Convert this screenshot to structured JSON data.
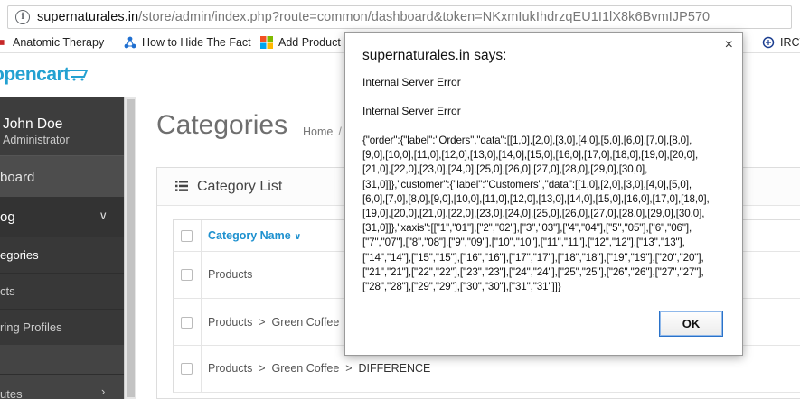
{
  "browser": {
    "url_host": "supernaturales.in",
    "url_path": "/store/admin/index.php?route=common/dashboard&token=NKxmIukIhdrzqEU1I1lX8k6BvmIJP570",
    "bookmarks": [
      {
        "label": "Anatomic Therapy",
        "icon": "red-bookmark-icon"
      },
      {
        "label": "How to Hide The Fact",
        "icon": "network-icon"
      },
      {
        "label": "Add Product C",
        "icon": "windows-icon"
      },
      {
        "label": "IRCT",
        "icon": "irctc-icon"
      }
    ]
  },
  "app": {
    "logo": "opencart",
    "user_name": "John Doe",
    "user_role": "Administrator"
  },
  "sidebar": {
    "dashboard": "board",
    "catalog": "og",
    "categories": "egories",
    "products": "cts",
    "recurring": "ring Profiles",
    "routes": "utes"
  },
  "page": {
    "title": "Categories",
    "breadcrumb_home": "Home",
    "breadcrumb_sep": "/"
  },
  "panel": {
    "title": "Category List",
    "column_header": "Category Name",
    "rows": [
      {
        "path": "Products",
        "leaf": ""
      },
      {
        "path": "Products  >  Green Coffee",
        "leaf": ""
      },
      {
        "path": "Products  >  Green Coffee  >  ",
        "leaf": "DIFFERENCE"
      }
    ]
  },
  "dialog": {
    "title": "supernaturales.in says:",
    "message1": "Internal Server Error",
    "message2": "Internal Server Error",
    "json_text": "{\"order\":{\"label\":\"Orders\",\"data\":[[1,0],[2,0],[3,0],[4,0],[5,0],[6,0],[7,0],[8,0],\n[9,0],[10,0],[11,0],[12,0],[13,0],[14,0],[15,0],[16,0],[17,0],[18,0],[19,0],[20,0],\n[21,0],[22,0],[23,0],[24,0],[25,0],[26,0],[27,0],[28,0],[29,0],[30,0],\n[31,0]]},\"customer\":{\"label\":\"Customers\",\"data\":[[1,0],[2,0],[3,0],[4,0],[5,0],\n[6,0],[7,0],[8,0],[9,0],[10,0],[11,0],[12,0],[13,0],[14,0],[15,0],[16,0],[17,0],[18,0],\n[19,0],[20,0],[21,0],[22,0],[23,0],[24,0],[25,0],[26,0],[27,0],[28,0],[29,0],[30,0],\n[31,0]]},\"xaxis\":[[\"1\",\"01\"],[\"2\",\"02\"],[\"3\",\"03\"],[\"4\",\"04\"],[\"5\",\"05\"],[\"6\",\"06\"],\n[\"7\",\"07\"],[\"8\",\"08\"],[\"9\",\"09\"],[\"10\",\"10\"],[\"11\",\"11\"],[\"12\",\"12\"],[\"13\",\"13\"],\n[\"14\",\"14\"],[\"15\",\"15\"],[\"16\",\"16\"],[\"17\",\"17\"],[\"18\",\"18\"],[\"19\",\"19\"],[\"20\",\"20\"],\n[\"21\",\"21\"],[\"22\",\"22\"],[\"23\",\"23\"],[\"24\",\"24\"],[\"25\",\"25\"],[\"26\",\"26\"],[\"27\",\"27\"],\n[\"28\",\"28\"],[\"29\",\"29\"],[\"30\",\"30\"],[\"31\",\"31\"]]}",
    "ok_label": "OK",
    "close_glyph": "×"
  },
  "colors": {
    "brand": "#23a1d1",
    "link": "#1e91cf",
    "sidebar_bg": "#444444"
  }
}
